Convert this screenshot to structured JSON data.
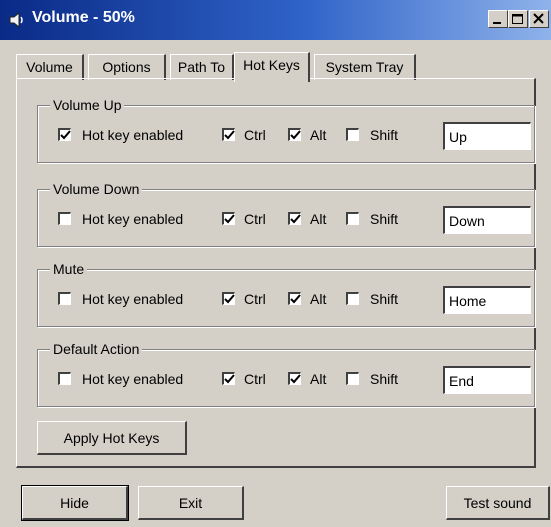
{
  "window": {
    "title": "Volume - 50%",
    "icon": "speaker-icon",
    "controls": [
      "minimize-icon",
      "maximize-icon",
      "close-icon"
    ]
  },
  "tabs": [
    {
      "label": "Volume",
      "active": false
    },
    {
      "label": "Options",
      "active": false
    },
    {
      "label": "Path To",
      "active": false
    },
    {
      "label": "Hot Keys",
      "active": true
    },
    {
      "label": "System Tray",
      "active": false
    }
  ],
  "hotkeys": [
    {
      "group": "Volume Up",
      "enabled_label": "Hot key enabled",
      "enabled": true,
      "ctrl": true,
      "alt": true,
      "shift": false,
      "key": "Up"
    },
    {
      "group": "Volume Down",
      "enabled_label": "Hot key enabled",
      "enabled": false,
      "ctrl": true,
      "alt": true,
      "shift": false,
      "key": "Down"
    },
    {
      "group": "Mute",
      "enabled_label": "Hot key enabled",
      "enabled": false,
      "ctrl": true,
      "alt": true,
      "shift": false,
      "key": "Home"
    },
    {
      "group": "Default Action",
      "enabled_label": "Hot key enabled",
      "enabled": false,
      "ctrl": true,
      "alt": true,
      "shift": false,
      "key": "End"
    }
  ],
  "modifier_labels": {
    "ctrl": "Ctrl",
    "alt": "Alt",
    "shift": "Shift"
  },
  "buttons": {
    "apply": "Apply Hot Keys",
    "hide": "Hide",
    "exit": "Exit",
    "test_sound": "Test sound"
  },
  "colors": {
    "title_bar_start": "#0a2a86",
    "title_bar_end": "#8fb2ea",
    "face": "#d4d0c8"
  }
}
